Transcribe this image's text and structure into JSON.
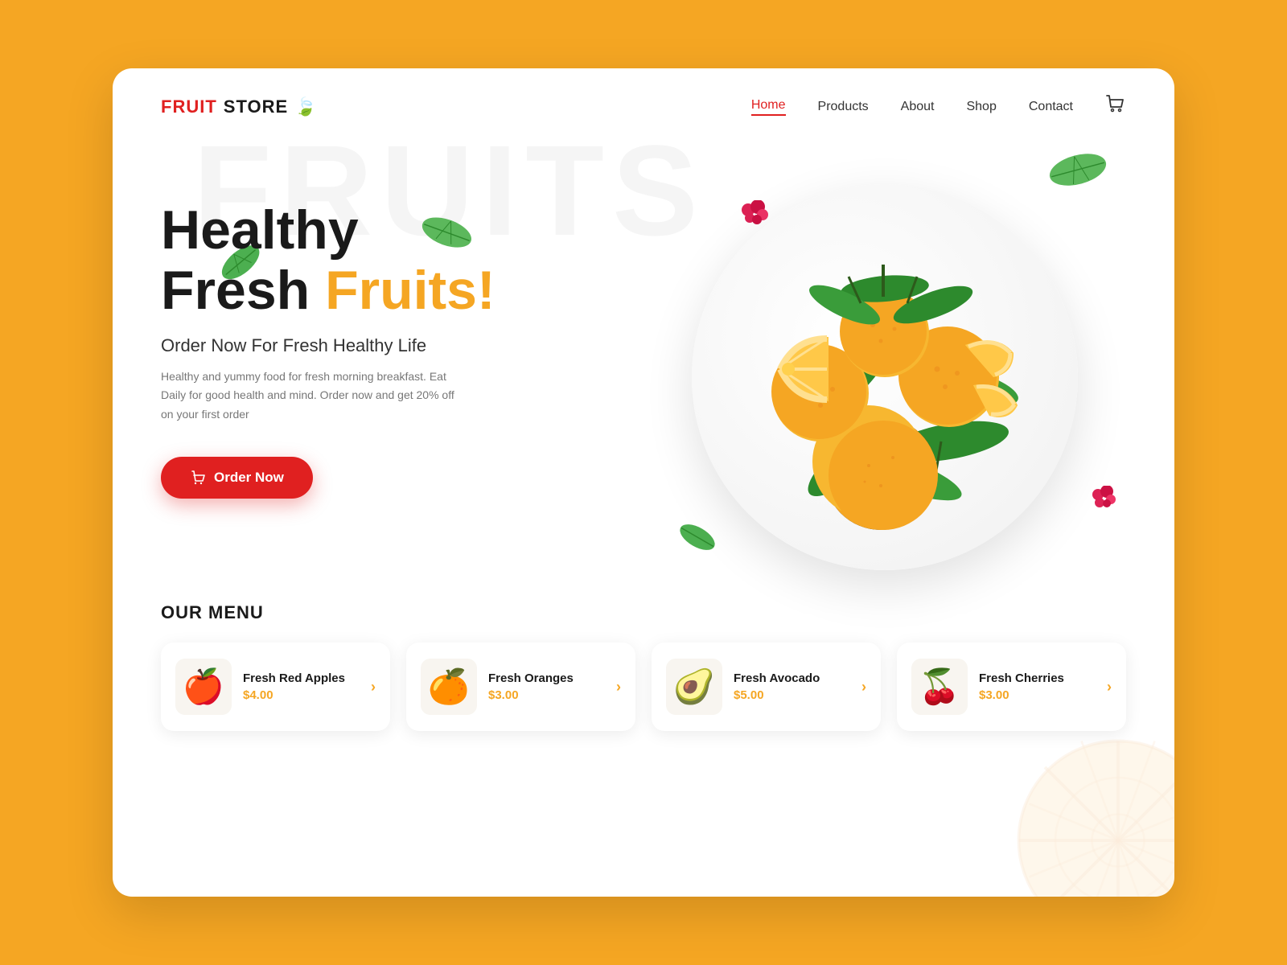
{
  "brand": {
    "fruit": "FRUIT",
    "store": " STORE",
    "icon": "🍃"
  },
  "nav": {
    "items": [
      {
        "label": "Home",
        "active": true
      },
      {
        "label": "Products",
        "active": false
      },
      {
        "label": "About",
        "active": false
      },
      {
        "label": "Shop",
        "active": false
      },
      {
        "label": "Contact",
        "active": false
      }
    ]
  },
  "hero": {
    "title_line1": "Healthy",
    "title_line2_black": "Fresh",
    "title_line2_orange": "Fruits!",
    "subtitle": "Order Now For Fresh Healthy Life",
    "description": "Healthy and yummy food for fresh morning breakfast. Eat Daily for good health and mind. Order now and get 20% off on your first order",
    "cta_label": "Order Now"
  },
  "bg_text": "FRUITS",
  "menu": {
    "section_title": "OUR MENU",
    "items": [
      {
        "name": "Fresh Red Apples",
        "price": "$4.00",
        "emoji": "🍎"
      },
      {
        "name": "Fresh Oranges",
        "price": "$3.00",
        "emoji": "🍊"
      },
      {
        "name": "Fresh Avocado",
        "price": "$5.00",
        "emoji": "🥑"
      },
      {
        "name": "Fresh Cherries",
        "price": "$3.00",
        "emoji": "🍒"
      }
    ]
  }
}
